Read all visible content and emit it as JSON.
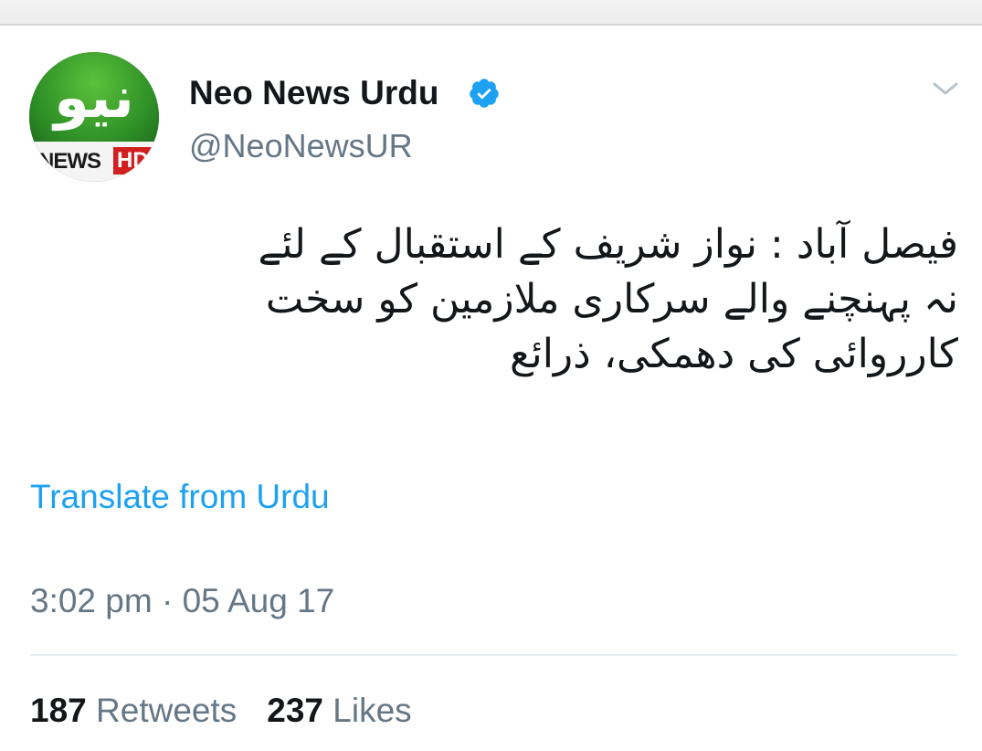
{
  "author": {
    "display_name": "Neo News Urdu",
    "handle": "@NeoNewsUR",
    "verified": true,
    "avatar": {
      "glyph": "نیو",
      "news_text": "NEWS",
      "hd_text": "HD"
    }
  },
  "tweet": {
    "lines": [
      "فیصل آباد : نواز شریف کے استقبال کے لئے",
      "نہ پہنچنے والے سرکاری ملازمین کو سخت",
      "کارروائی کی دھمکی، ذرائع"
    ]
  },
  "translate_label": "Translate from Urdu",
  "timestamp": "3:02 pm · 05 Aug 17",
  "stats": {
    "retweets_count": "187",
    "retweets_label": "Retweets",
    "likes_count": "237",
    "likes_label": "Likes"
  },
  "colors": {
    "link": "#1da1f2",
    "secondary_text": "#657786",
    "primary_text": "#14171a",
    "verified": "#1da1f2"
  },
  "icons": {
    "verified": "verified-badge-icon",
    "menu": "chevron-down-icon"
  }
}
